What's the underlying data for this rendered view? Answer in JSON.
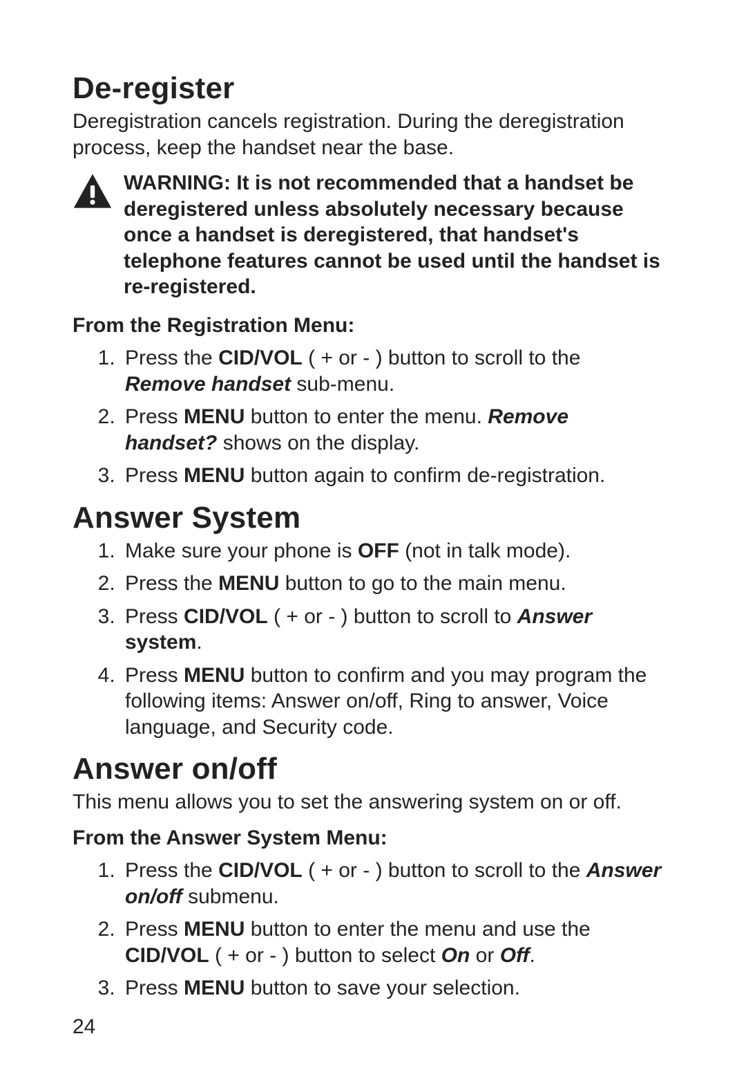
{
  "section1": {
    "title": "De-register",
    "intro": "Deregistration cancels registration. During the deregistration process, keep the handset near the base.",
    "warning_label": "WARNING:",
    "warning_body": " It is not recommended that a handset be deregistered unless absolutely necessary because once a handset is deregistered, that handset's telephone features cannot be used until the handset is re-registered.",
    "subhead": "From the Registration Menu:",
    "step1_a": "Press the ",
    "step1_b": "CID/VOL",
    "step1_c": " ( + or - ) button to scroll to the ",
    "step1_d": "Remove handset",
    "step1_e": " sub-menu.",
    "step2_a": "Press ",
    "step2_b": "MENU",
    "step2_c": " button to enter the menu. ",
    "step2_d": "Remove handset?",
    "step2_e": " shows on the display.",
    "step3_a": "Press ",
    "step3_b": "MENU",
    "step3_c": " button again to confirm de-registration."
  },
  "section2": {
    "title": "Answer System",
    "step1_a": "Make sure your phone is ",
    "step1_b": "OFF",
    "step1_c": " (not in talk mode).",
    "step2_a": "Press the ",
    "step2_b": "MENU",
    "step2_c": " button to go to the main menu.",
    "step3_a": "Press ",
    "step3_b": "CID/VOL",
    "step3_c": " ( + or - ) button to scroll to ",
    "step3_d": "Answer",
    "step3_e": " ",
    "step3_f": "system",
    "step3_g": ".",
    "step4_a": "Press ",
    "step4_b": "MENU",
    "step4_c": " button to confirm and you may program the following items: Answer on/off, Ring to answer, Voice language, and Security code."
  },
  "section3": {
    "title": "Answer on/off",
    "intro": "This menu allows you to set the answering system on or off.",
    "subhead": "From the Answer System Menu:",
    "step1_a": "Press the ",
    "step1_b": "CID/VOL",
    "step1_c": " ( + or - ) button to scroll to the ",
    "step1_d": "Answer on/off",
    "step1_e": " submenu.",
    "step2_a": "Press ",
    "step2_b": "MENU",
    "step2_c": " button to enter the menu and use the ",
    "step2_d": "CID/VOL",
    "step2_e": " ( + or - ) button to select ",
    "step2_f": "On",
    "step2_g": " or ",
    "step2_h": "Off",
    "step2_i": ".",
    "step3_a": "Press ",
    "step3_b": "MENU",
    "step3_c": " button to save your selection."
  },
  "page_number": "24"
}
